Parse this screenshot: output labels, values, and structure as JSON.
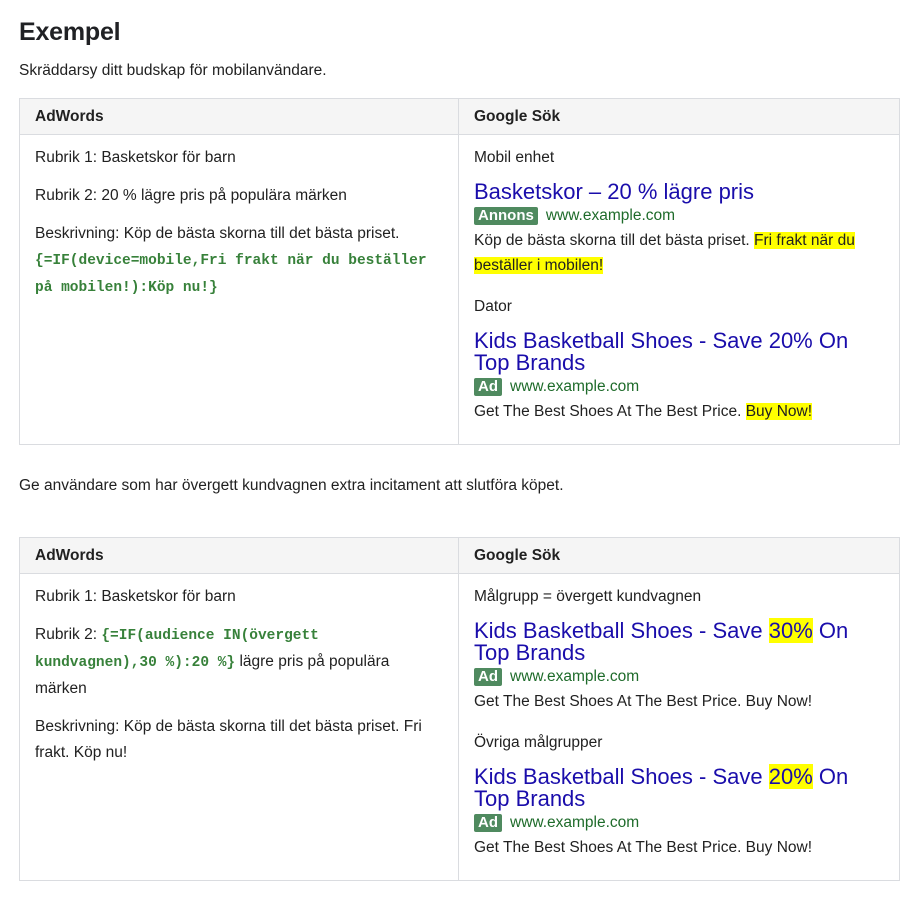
{
  "heading": "Exempel",
  "intro": "Skräddarsy ditt budskap för mobilanvändare.",
  "between_text": "Ge användare som har övergett kundvagnen extra incitament att slutföra köpet.",
  "table1": {
    "col1_header": "AdWords",
    "col2_header": "Google Sök",
    "left": {
      "rubrik1": "Rubrik 1: Basketskor för barn",
      "rubrik2": "Rubrik 2: 20 % lägre pris på populära märken",
      "beskrivning_prefix": "Beskrivning: Köp de bästa skorna till det bästa priset. ",
      "beskrivning_code": "{=IF(device=mobile,Fri frakt när du beställer på mobilen!):Köp nu!}"
    },
    "right": {
      "mobile_label": "Mobil enhet",
      "mobile_ad": {
        "title": "Basketskor – 20 % lägre pris",
        "badge": "Annons",
        "url": "www.example.com",
        "desc": "Köp de bästa skorna till det bästa priset. ",
        "desc_highlight": "Fri frakt när du beställer i mobilen!"
      },
      "desktop_label": "Dator",
      "desktop_ad": {
        "title": "Kids Basketball Shoes - Save 20% On Top Brands",
        "badge": "Ad",
        "url": "www.example.com",
        "desc": "Get The Best Shoes At The Best Price. ",
        "desc_highlight": "Buy Now!"
      }
    }
  },
  "table2": {
    "col1_header": "AdWords",
    "col2_header": "Google Sök",
    "left": {
      "rubrik1": "Rubrik 1: Basketskor för barn",
      "rubrik2_prefix": "Rubrik 2: ",
      "rubrik2_code": "{=IF(audience IN(övergett kundvagnen),30 %):20 %}",
      "rubrik2_suffix": " lägre pris på populära märken",
      "beskrivning": "Beskrivning: Köp de bästa skorna till det bästa priset. Fri frakt. Köp nu!"
    },
    "right": {
      "audience_label": "Målgrupp = övergett kundvagnen",
      "audience_ad": {
        "title_prefix": "Kids Basketball Shoes - Save ",
        "title_highlight": "30%",
        "title_suffix": " On Top Brands",
        "badge": "Ad",
        "url": "www.example.com",
        "desc": "Get The Best Shoes At The Best Price. Buy Now!"
      },
      "other_label": "Övriga målgrupper",
      "other_ad": {
        "title_prefix": "Kids Basketball Shoes - Save ",
        "title_highlight": "20%",
        "title_suffix": " On Top Brands",
        "badge": "Ad",
        "url": "www.example.com",
        "desc": "Get The Best Shoes At The Best Price. Buy Now!"
      }
    }
  }
}
